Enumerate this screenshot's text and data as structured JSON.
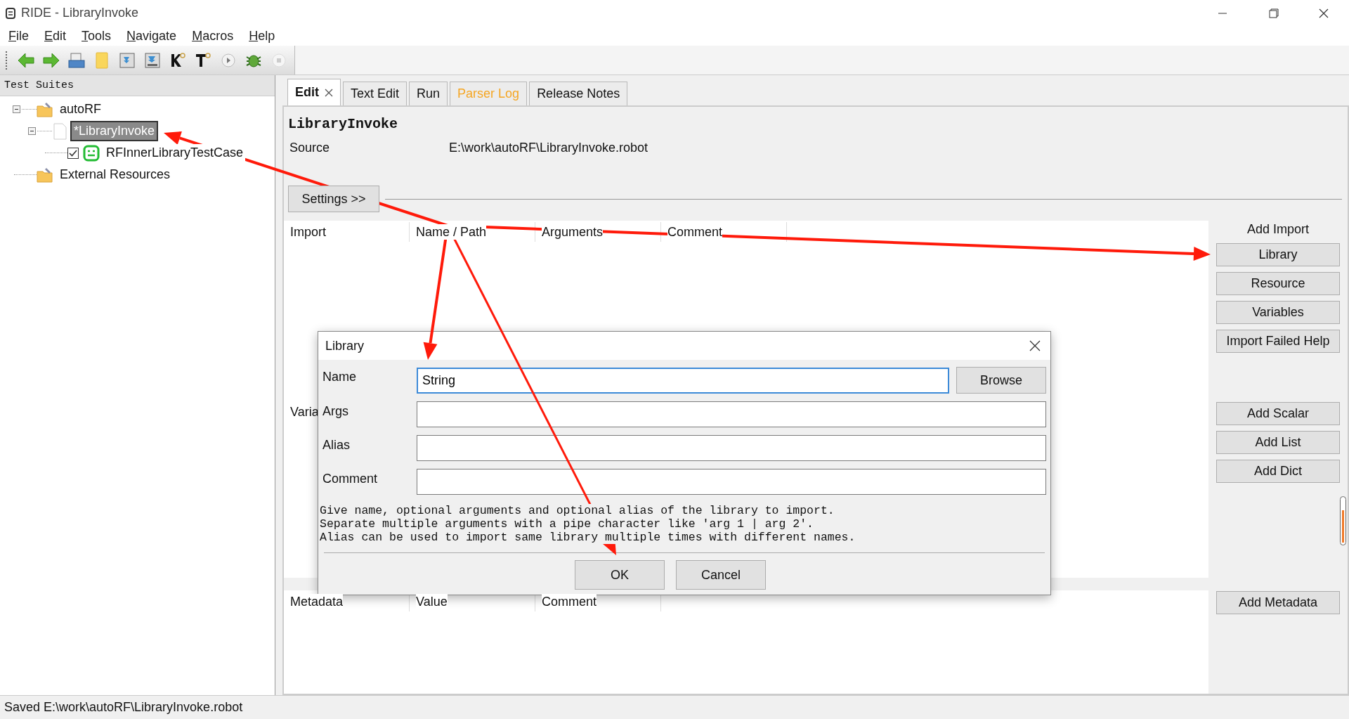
{
  "window": {
    "title": "RIDE - LibraryInvoke"
  },
  "menu": [
    "File",
    "Edit",
    "Tools",
    "Navigate",
    "Macros",
    "Help"
  ],
  "tree": {
    "title": "Test Suites",
    "items": [
      {
        "label": "autoRF",
        "kind": "suite",
        "expanded": true,
        "selected": false,
        "children": [
          {
            "label": "*LibraryInvoke",
            "kind": "file",
            "expanded": true,
            "selected": true,
            "children": [
              {
                "label": "RFInnerLibraryTestCase",
                "kind": "test",
                "selected": false,
                "checked": true
              }
            ]
          }
        ]
      },
      {
        "label": "External Resources",
        "kind": "suite",
        "selected": false
      }
    ]
  },
  "tabs": [
    {
      "label": "Edit",
      "selected": true,
      "closable": true,
      "highlighted": false
    },
    {
      "label": "Text Edit",
      "selected": false,
      "closable": false,
      "highlighted": false
    },
    {
      "label": "Run",
      "selected": false,
      "closable": false,
      "highlighted": false
    },
    {
      "label": "Parser Log",
      "selected": false,
      "closable": false,
      "highlighted": true
    },
    {
      "label": "Release Notes",
      "selected": false,
      "closable": false,
      "highlighted": false
    }
  ],
  "editor": {
    "title": "LibraryInvoke",
    "source": {
      "label": "Source",
      "value": "E:\\work\\autoRF\\LibraryInvoke.robot"
    },
    "settings_button": "Settings >>",
    "import_table": {
      "columns": [
        "Import",
        "Name / Path",
        "Arguments",
        "Comment"
      ]
    },
    "variable_table": {
      "columns": [
        "Varia"
      ]
    },
    "metadata_table": {
      "columns": [
        "Metadata",
        "Value",
        "Comment"
      ]
    },
    "import_buttons": {
      "title": "Add Import",
      "buttons": [
        "Library",
        "Resource",
        "Variables",
        "Import Failed Help"
      ]
    },
    "variable_buttons": [
      "Add Scalar",
      "Add List",
      "Add Dict"
    ],
    "metadata_buttons": [
      "Add Metadata"
    ]
  },
  "dialog": {
    "title": "Library",
    "fields": [
      {
        "label": "Name",
        "value": "String",
        "focused": true
      },
      {
        "label": "Args",
        "focused": false
      },
      {
        "label": "Alias",
        "focused": false
      },
      {
        "label": "Comment",
        "focused": false
      }
    ],
    "browse_button": "Browse",
    "help": [
      "Give name, optional arguments and optional alias of the library to import.",
      "Separate multiple arguments with a pipe character like 'arg 1 | arg 2'.",
      "Alias can be used to import same library multiple times with different names."
    ],
    "buttons": [
      "OK",
      "Cancel"
    ]
  },
  "status_bar": "Saved E:\\work\\autoRF\\LibraryInvoke.robot"
}
